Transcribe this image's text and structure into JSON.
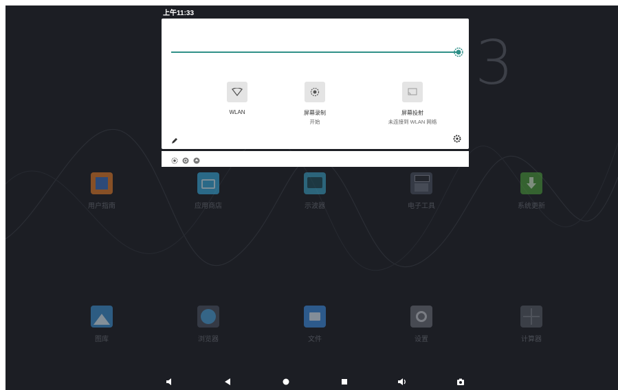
{
  "status_bar": {
    "time": "上午11:33"
  },
  "clock_partial": "3",
  "quick_settings": {
    "tiles": [
      {
        "label": "WLAN",
        "sub": "",
        "icon": "wifi-icon"
      },
      {
        "label": "屏幕录制",
        "sub": "开始",
        "icon": "screen-record-icon"
      },
      {
        "label": "屏幕投射",
        "sub": "未连接到 WLAN 网络",
        "icon": "cast-icon"
      }
    ],
    "brightness_level": 1.0
  },
  "apps_row1": [
    {
      "label": "用户指南",
      "color": "#e07a28"
    },
    {
      "label": "应用商店",
      "color": "#37a7d8"
    },
    {
      "label": "示波器",
      "color": "#3a9fc2"
    },
    {
      "label": "电子工具",
      "color": "#4a5160"
    },
    {
      "label": "系统更新",
      "color": "#4a9a3a"
    }
  ],
  "apps_row2": [
    {
      "label": "图库",
      "color": "#3b8fd0"
    },
    {
      "label": "浏览器",
      "color": "#4aa0d8"
    },
    {
      "label": "文件",
      "color": "#3c8ce0"
    },
    {
      "label": "设置",
      "color": "#6b6f78"
    },
    {
      "label": "计算器",
      "color": "#555a64"
    }
  ],
  "nav_bar": [
    "volume-down-icon",
    "back-icon",
    "home-icon",
    "recents-icon",
    "volume-up-icon",
    "screenshot-icon"
  ]
}
